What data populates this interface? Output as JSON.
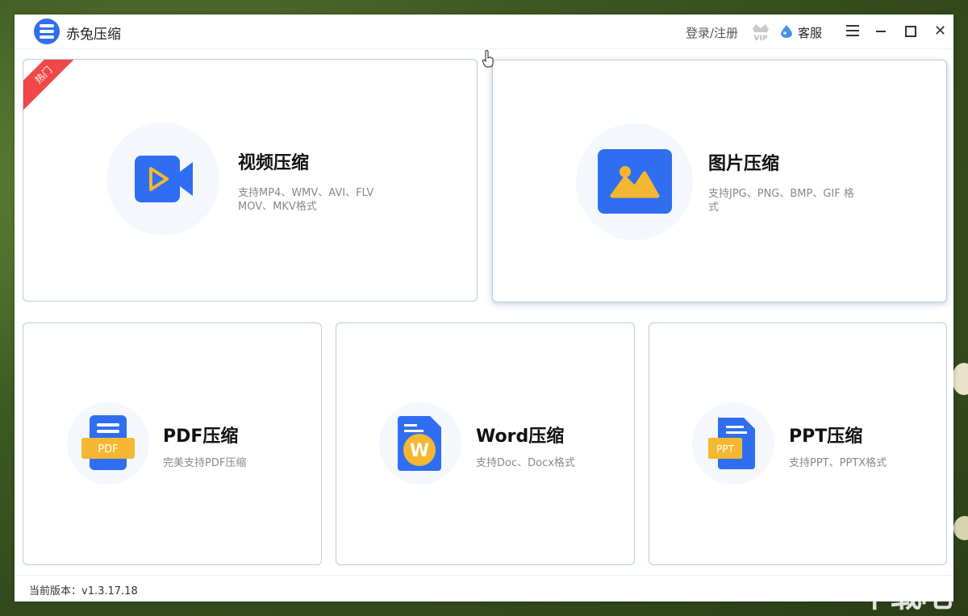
{
  "app": {
    "title": "赤兔压缩",
    "version_label": "当前版本：v1.3.17.18"
  },
  "header": {
    "login": "登录/注册",
    "vip": "VIP",
    "service": "客服"
  },
  "cards": {
    "video": {
      "badge": "热门",
      "title": "视频压缩",
      "desc_line1": "支持MP4、WMV、AVI、FLV",
      "desc_line2": "MOV、MKV格式"
    },
    "image": {
      "title": "图片压缩",
      "desc_line1": "支持JPG、PNG、BMP、GIF 格",
      "desc_line2": "式"
    },
    "pdf": {
      "title": "PDF压缩",
      "desc": "完美支持PDF压缩",
      "icon_text": "PDF"
    },
    "word": {
      "title": "Word压缩",
      "desc": "支持Doc、Docx格式",
      "icon_text": "W"
    },
    "ppt": {
      "title": "PPT压缩",
      "desc": "支持PPT、PPTX格式",
      "icon_text": "PPT"
    }
  },
  "watermark": "下载吧",
  "colors": {
    "accent": "#2f6ef0",
    "yellow": "#f5b731",
    "hot": "#f04848",
    "card_border": "#b9cde0"
  },
  "icons": [
    "logo-icon",
    "vip-crown-icon",
    "customer-service-icon",
    "menu-icon",
    "minimize-icon",
    "maximize-icon",
    "close-icon",
    "video-camera-icon",
    "image-icon",
    "pdf-icon",
    "word-icon",
    "ppt-icon"
  ]
}
